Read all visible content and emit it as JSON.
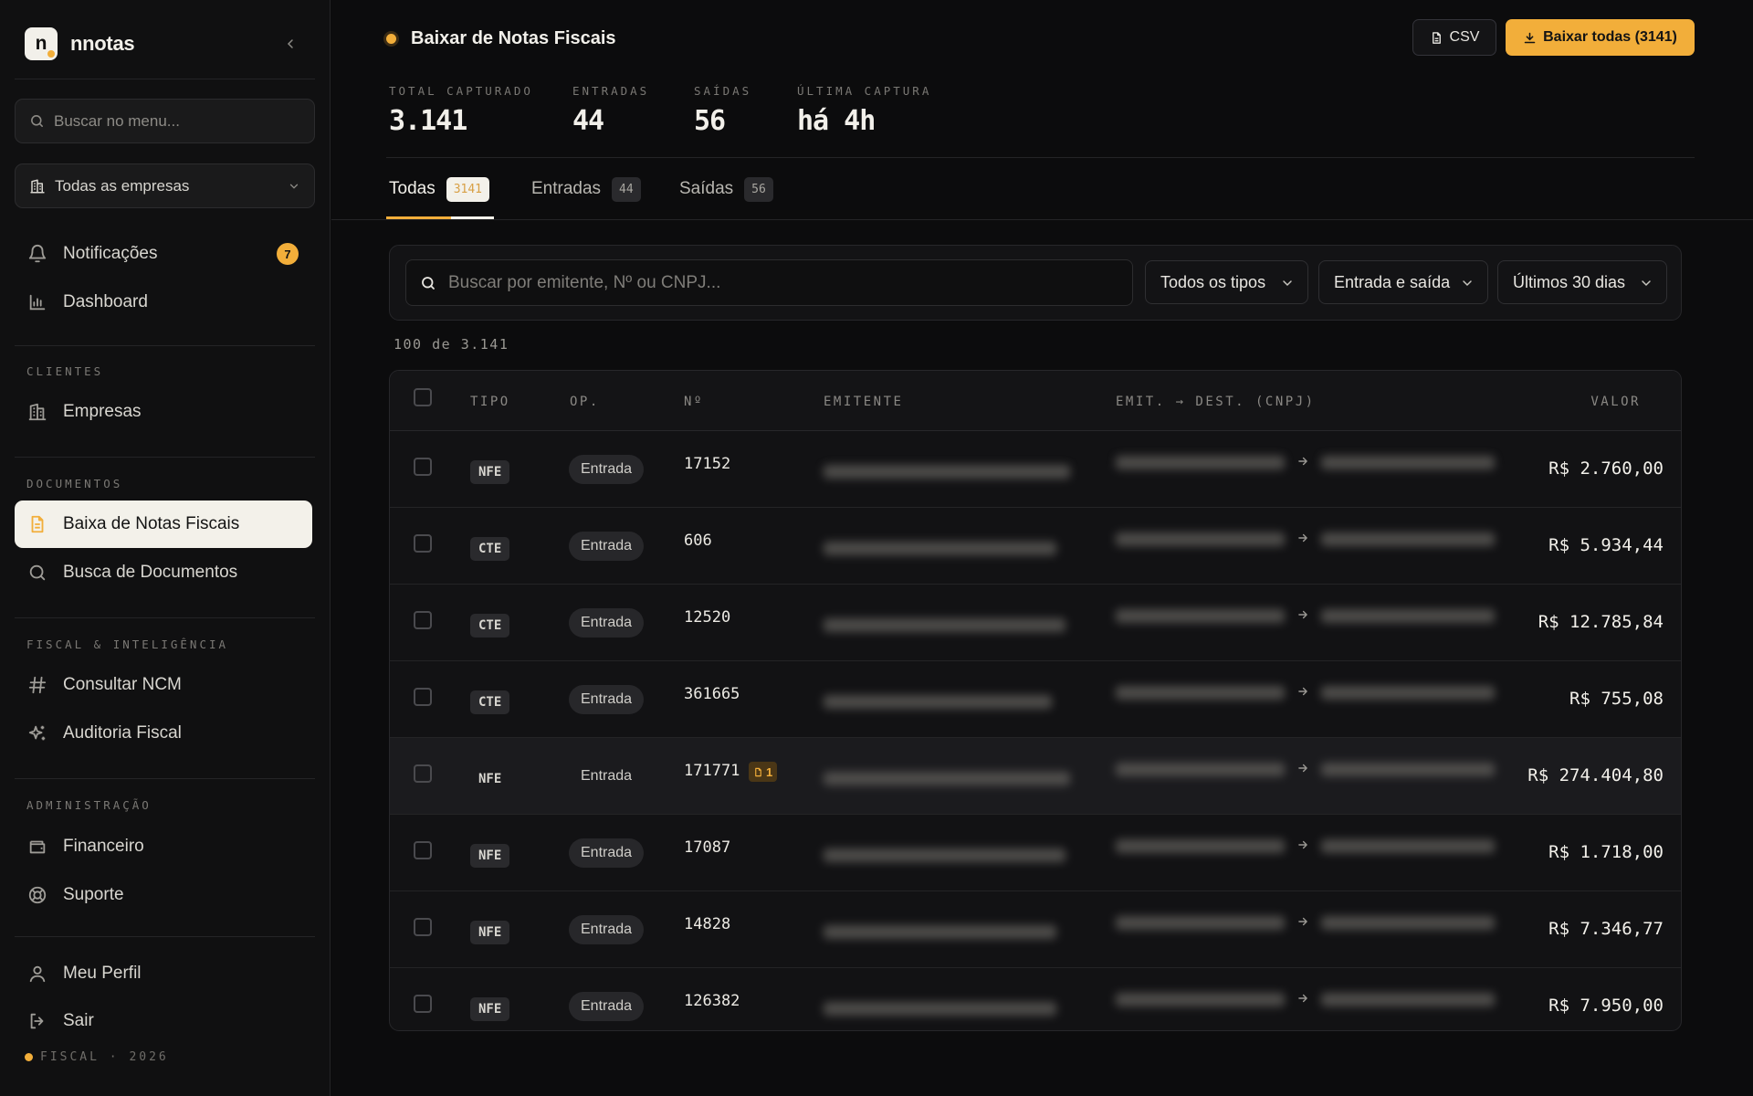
{
  "app": {
    "logo_letter": "n",
    "name": "nnotas",
    "accent": "#f2ae3a"
  },
  "sidebar": {
    "search_placeholder": "Buscar no menu...",
    "company_select": "Todas as empresas",
    "items_top": [
      {
        "label": "Notificações",
        "icon": "bell-icon",
        "badge": "7"
      },
      {
        "label": "Dashboard",
        "icon": "bar-chart-icon"
      }
    ],
    "sections": [
      {
        "title": "CLIENTES",
        "items": [
          {
            "label": "Empresas",
            "icon": "building-icon"
          }
        ]
      },
      {
        "title": "DOCUMENTOS",
        "items": [
          {
            "label": "Baixa de Notas Fiscais",
            "icon": "file-text-icon",
            "active": true
          },
          {
            "label": "Busca de Documentos",
            "icon": "search-icon"
          }
        ]
      },
      {
        "title": "FISCAL & INTELIGÊNCIA",
        "items": [
          {
            "label": "Consultar NCM",
            "icon": "hash-icon"
          },
          {
            "label": "Auditoria Fiscal",
            "icon": "sparkles-icon"
          }
        ]
      },
      {
        "title": "ADMINISTRAÇÃO",
        "items": [
          {
            "label": "Financeiro",
            "icon": "wallet-icon"
          },
          {
            "label": "Suporte",
            "icon": "lifebuoy-icon"
          }
        ]
      }
    ],
    "bottom_items": [
      {
        "label": "Meu Perfil",
        "icon": "user-icon"
      },
      {
        "label": "Sair",
        "icon": "logout-icon"
      }
    ],
    "footer": "FISCAL · 2026"
  },
  "header": {
    "title": "Baixar de Notas Fiscais",
    "csv_label": "CSV",
    "download_all_label": "Baixar todas (3141)"
  },
  "stats": [
    {
      "label": "TOTAL CAPTURADO",
      "value": "3.141"
    },
    {
      "label": "ENTRADAS",
      "value": "44"
    },
    {
      "label": "SAÍDAS",
      "value": "56"
    },
    {
      "label": "ÚLTIMA CAPTURA",
      "value": "há 4h"
    }
  ],
  "tabs": [
    {
      "label": "Todas",
      "count": "3141",
      "active": true
    },
    {
      "label": "Entradas",
      "count": "44"
    },
    {
      "label": "Saídas",
      "count": "56"
    }
  ],
  "filters": {
    "search_placeholder": "Buscar por emitente, Nº ou CNPJ...",
    "type_select": "Todos os tipos",
    "direction_select": "Entrada e saída",
    "period_select": "Últimos 30 dias"
  },
  "results_count": "100 de 3.141",
  "table": {
    "columns": [
      "TIPO",
      "OP.",
      "Nº",
      "EMITENTE",
      "EMIT. → DEST. (CNPJ)",
      "VALOR"
    ],
    "rows": [
      {
        "tipo": "NFE",
        "op": "Entrada",
        "numero": "17152",
        "valor": "R$ 2.760,00"
      },
      {
        "tipo": "CTE",
        "op": "Entrada",
        "numero": "606",
        "valor": "R$ 5.934,44"
      },
      {
        "tipo": "CTE",
        "op": "Entrada",
        "numero": "12520",
        "valor": "R$ 12.785,84"
      },
      {
        "tipo": "CTE",
        "op": "Entrada",
        "numero": "361665",
        "valor": "R$ 755,08"
      },
      {
        "tipo": "NFE",
        "op": "Entrada",
        "numero": "171771",
        "attachments": "1",
        "valor": "R$ 274.404,80",
        "highlighted": true
      },
      {
        "tipo": "NFE",
        "op": "Entrada",
        "numero": "17087",
        "valor": "R$ 1.718,00"
      },
      {
        "tipo": "NFE",
        "op": "Entrada",
        "numero": "14828",
        "valor": "R$ 7.346,77"
      },
      {
        "tipo": "NFE",
        "op": "Entrada",
        "numero": "126382",
        "valor": "R$ 7.950,00"
      }
    ]
  }
}
